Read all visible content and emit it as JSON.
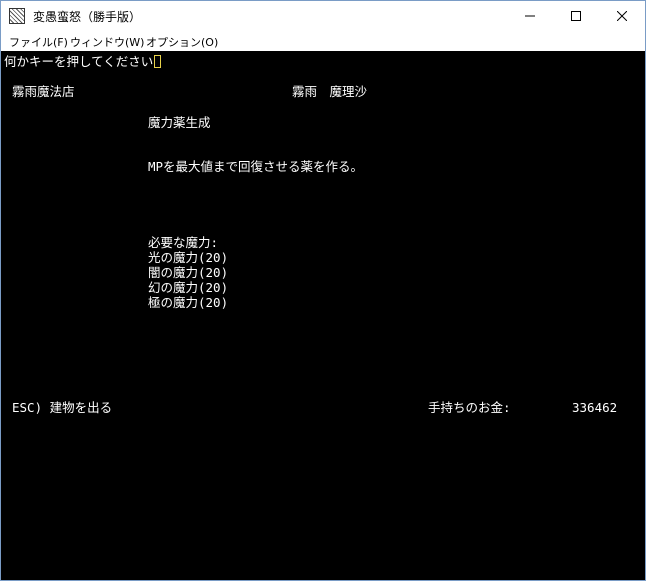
{
  "window": {
    "title": "変愚蛮怒（勝手版）",
    "controls": {
      "minimize": "—",
      "maximize": "☐",
      "close": "✕"
    }
  },
  "menu": [
    "ファイル(F)",
    "ウィンドウ(W)",
    "オプション(O)"
  ],
  "terminal": {
    "prompt": "何かキーを押してください",
    "shop_name": "霧雨魔法店",
    "owner": "霧雨　魔理沙",
    "item_name": "魔力薬生成",
    "description": "MPを最大値まで回復させる薬を作る。",
    "requirements_header": "必要な魔力:",
    "requirements": [
      "光の魔力(20)",
      "闇の魔力(20)",
      "幻の魔力(20)",
      "極の魔力(20)"
    ],
    "exit_hint": "ESC) 建物を出る",
    "gold_label": "手持ちのお金:",
    "gold_value": "336462"
  }
}
